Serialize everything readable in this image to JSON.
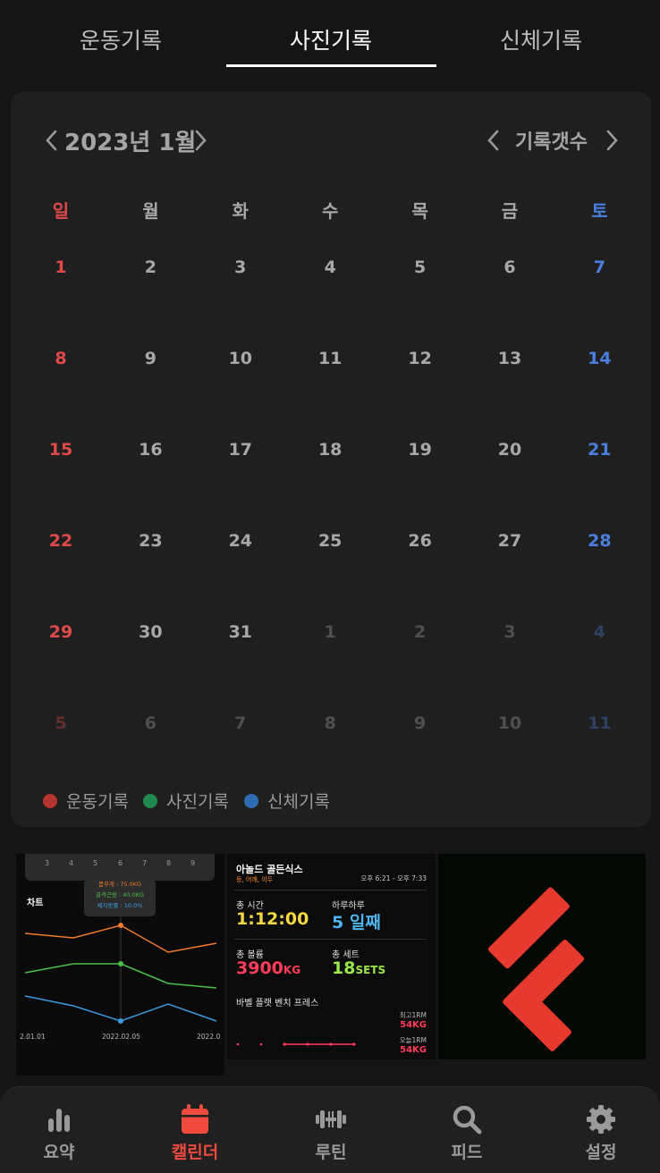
{
  "tabs": [
    {
      "label": "운동기록",
      "active": false
    },
    {
      "label": "사진기록",
      "active": true
    },
    {
      "label": "신체기록",
      "active": false
    }
  ],
  "calendar": {
    "month_title": "2023년 1월",
    "count_label": "기록갯수",
    "weekdays": [
      "일",
      "월",
      "화",
      "수",
      "목",
      "금",
      "토"
    ],
    "weeks": [
      [
        "1",
        "2",
        "3",
        "4",
        "5",
        "6",
        "7"
      ],
      [
        "8",
        "9",
        "10",
        "11",
        "12",
        "13",
        "14"
      ],
      [
        "15",
        "16",
        "17",
        "18",
        "19",
        "20",
        "21"
      ],
      [
        "22",
        "23",
        "24",
        "25",
        "26",
        "27",
        "28"
      ],
      [
        "29",
        "30",
        "31",
        "1",
        "2",
        "3",
        "4"
      ],
      [
        "5",
        "6",
        "7",
        "8",
        "9",
        "10",
        "11"
      ]
    ],
    "legend": [
      {
        "label": "운동기록",
        "color": "#b8322e"
      },
      {
        "label": "사진기록",
        "color": "#1e8a4c"
      },
      {
        "label": "신체기록",
        "color": "#2f6bb5"
      }
    ],
    "colors": {
      "sunday": "#e04a4a",
      "saturday": "#4a7fe0",
      "weekday": "#a8a8a8"
    }
  },
  "thumbnails": {
    "chart": {
      "mini_days": [
        "3",
        "4",
        "5",
        "6",
        "7",
        "8",
        "9"
      ],
      "title": "차트",
      "tooltip": [
        "몸무게 : 75.0KG",
        "골격근량 : 40.0KG",
        "체지방률 : 10.0%"
      ],
      "x_labels": [
        "2.01.01",
        "2022.02.05",
        "2022.0"
      ]
    },
    "workout": {
      "name": "아놀드 골든식스",
      "parts": "등, 어깨, 이두",
      "time": "오후 6:21 - 오후 7:33",
      "total_time_label": "총 시간",
      "total_time_value": "1:12:00",
      "streak_label": "하루하루",
      "streak_value": "5 일째",
      "volume_label": "총 볼륨",
      "volume_value": "3900",
      "volume_unit": "KG",
      "sets_label": "총 세트",
      "sets_value": "18",
      "sets_unit": "SETS",
      "exercise": "바벨 플랫 벤치 프레스",
      "best_label": "최고1RM",
      "best_value": "54KG",
      "today_label": "오늘1RM",
      "today_value": "54KG"
    },
    "logo": {
      "color": "#e8392f"
    }
  },
  "nav": [
    {
      "label": "요약",
      "icon": "bar-chart-icon",
      "active": false
    },
    {
      "label": "캘린더",
      "icon": "calendar-icon",
      "active": true
    },
    {
      "label": "루틴",
      "icon": "dumbbell-icon",
      "active": false
    },
    {
      "label": "피드",
      "icon": "search-icon",
      "active": false
    },
    {
      "label": "설정",
      "icon": "gear-icon",
      "active": false
    }
  ]
}
